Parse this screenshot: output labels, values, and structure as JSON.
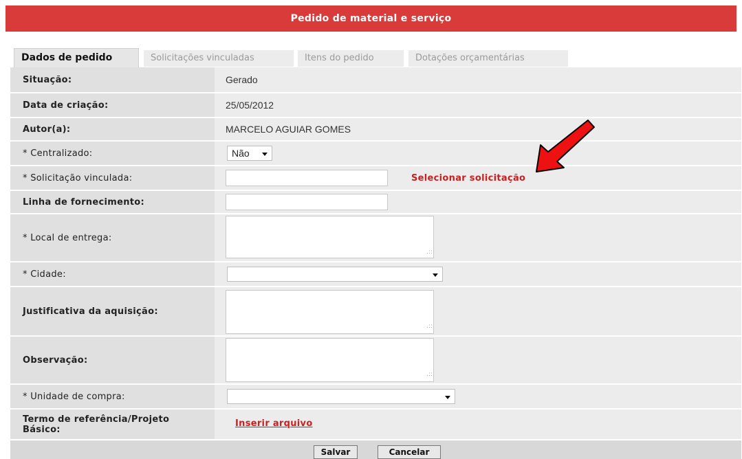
{
  "header": {
    "title": "Pedido de material e serviço"
  },
  "tabs": [
    {
      "label": "Dados de pedido",
      "active": true
    },
    {
      "label": "Solicitações vinculadas",
      "active": false
    },
    {
      "label": "Itens do pedido",
      "active": false
    },
    {
      "label": "Dotações orçamentárias",
      "active": false
    }
  ],
  "form": {
    "situacao": {
      "label": "Situação:",
      "value": "Gerado"
    },
    "data_criacao": {
      "label": "Data de criação:",
      "value": "25/05/2012"
    },
    "autor": {
      "label": "Autor(a):",
      "value": "MARCELO AGUIAR GOMES"
    },
    "centralizado": {
      "label": "* Centralizado:",
      "value": "Não"
    },
    "solicitacao": {
      "label": "* Solicitação vinculada:",
      "value": "",
      "link": "Selecionar solicitação"
    },
    "linha": {
      "label": "Linha de fornecimento:",
      "value": ""
    },
    "local": {
      "label": "* Local de entrega:",
      "value": ""
    },
    "cidade": {
      "label": "* Cidade:",
      "value": ""
    },
    "justificativa": {
      "label": "Justificativa da aquisição:",
      "value": ""
    },
    "observacao": {
      "label": "Observação:",
      "value": ""
    },
    "unidade": {
      "label": "* Unidade de compra:",
      "value": ""
    },
    "termo": {
      "label_line1": "Termo de referência/Projeto",
      "label_line2": "Básico:",
      "link": "Inserir arquivo"
    }
  },
  "footer": {
    "save_label": "Salvar",
    "cancel_label": "Cancelar"
  },
  "colors": {
    "header_bg": "#d93a3a",
    "link_red": "#cc1f1f",
    "arrow_red": "#ee1111"
  },
  "icons": {
    "dropdown": "chevron-down-icon",
    "annotation": "red-arrow-icon"
  }
}
